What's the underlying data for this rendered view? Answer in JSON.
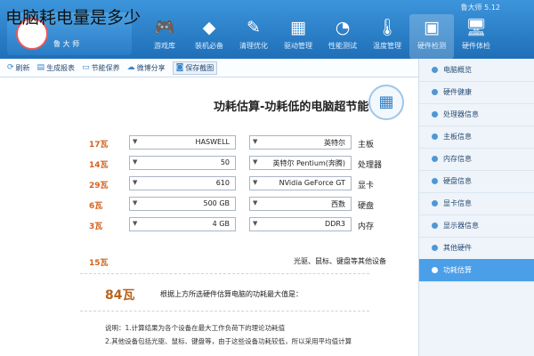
{
  "overlay_title": "电脑耗电量是多少",
  "window_title": "鲁大师 5.12",
  "logo": {
    "text": "鲁 大 师"
  },
  "top_nav": [
    {
      "icon": "gamepad-icon",
      "glyph": "🎮",
      "label": "游戏库"
    },
    {
      "icon": "cube-icon",
      "glyph": "◆",
      "label": "装机必备"
    },
    {
      "icon": "broom-icon",
      "glyph": "✎",
      "label": "清理优化"
    },
    {
      "icon": "chip-icon",
      "glyph": "▦",
      "label": "驱动管理"
    },
    {
      "icon": "gauge-icon",
      "glyph": "◔",
      "label": "性能测试"
    },
    {
      "icon": "thermometer-icon",
      "glyph": "🌡",
      "label": "温度管理"
    },
    {
      "icon": "hardware-icon",
      "glyph": "▣",
      "label": "硬件检测"
    },
    {
      "icon": "monitor-icon",
      "glyph": "🖥",
      "label": "硬件体检"
    }
  ],
  "toolbar": {
    "save_screenshot": "保存截图",
    "share": "微博分享",
    "power_saver": "节能保养",
    "generate_report": "生成报表",
    "refresh": "刷新"
  },
  "section_title": "功耗估算-功耗低的电脑超节能",
  "rows": [
    {
      "label": "主板",
      "brand": "英特尔",
      "model": "HASWELL",
      "watts": "17瓦"
    },
    {
      "label": "处理器",
      "brand": "英特尔 Pentium(奔腾)",
      "model": "50",
      "watts": "14瓦"
    },
    {
      "label": "显卡",
      "brand": "NVidia GeForce GT",
      "model": "610",
      "watts": "29瓦"
    },
    {
      "label": "硬盘",
      "brand": "西数",
      "model": "500 GB",
      "watts": "6瓦"
    },
    {
      "label": "内存",
      "brand": "DDR3",
      "model": "4 GB",
      "watts": "3瓦"
    }
  ],
  "others": {
    "label": "光驱、鼠标、键盘等其他设备",
    "watts": "15瓦"
  },
  "result": {
    "text": "根据上方所选硬件估算电脑的功耗最大值是：",
    "value": "84瓦"
  },
  "notes": [
    "说明：1.计算结果为各个设备在最大工作负荷下的理论功耗值",
    "2.其他设备包括光驱、鼠标、键盘等，由于这些设备功耗较低，所以采用平均值计算"
  ],
  "sidebar": [
    {
      "label": "电脑概览",
      "active": false
    },
    {
      "label": "硬件健康",
      "active": false
    },
    {
      "label": "处理器信息",
      "active": false
    },
    {
      "label": "主板信息",
      "active": false
    },
    {
      "label": "内存信息",
      "active": false
    },
    {
      "label": "硬盘信息",
      "active": false
    },
    {
      "label": "显卡信息",
      "active": false
    },
    {
      "label": "显示器信息",
      "active": false
    },
    {
      "label": "其他硬件",
      "active": false
    },
    {
      "label": "功耗估算",
      "active": true
    }
  ]
}
